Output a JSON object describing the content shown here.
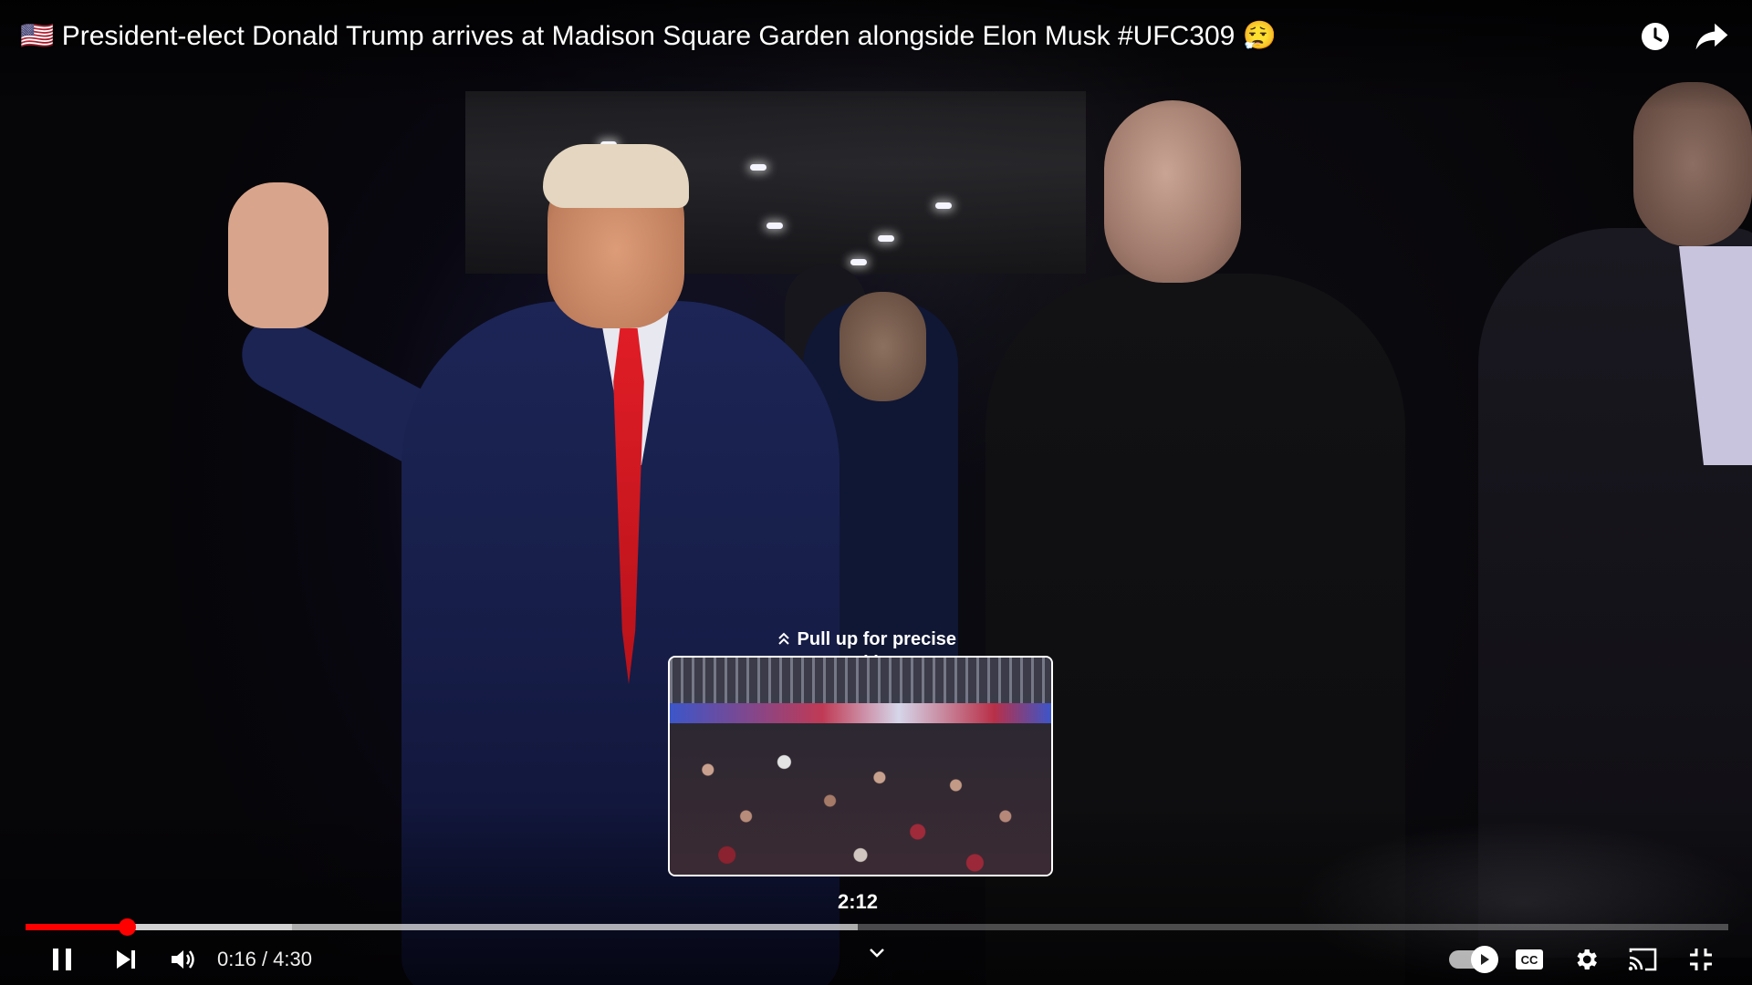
{
  "video": {
    "title": "🇺🇸 President-elect Donald Trump arrives at Madison Square Garden alongside Elon Musk #UFC309 😮‍💨"
  },
  "top_actions": [
    {
      "icon": "watch-later-icon"
    },
    {
      "icon": "share-icon"
    }
  ],
  "seek_preview": {
    "hint": "Pull up for precise seeking",
    "hint_icon": "double-chevron-up-icon",
    "time": "2:12"
  },
  "progress": {
    "played_fraction": 0.0593,
    "hover_fraction": 0.489,
    "buffered_fraction": 0.1567,
    "played_color": "#ff0000"
  },
  "controls": {
    "current_time": "0:16",
    "separator": " / ",
    "duration": "4:30",
    "autoplay_on": true,
    "icons": [
      "pause-icon",
      "next-icon",
      "volume-icon",
      "chevron-down-icon",
      "autoplay-toggle",
      "captions-icon",
      "settings-icon",
      "cast-icon",
      "exit-fullscreen-icon"
    ]
  },
  "colors": {
    "accent": "#ff0000",
    "text": "#ffffff"
  }
}
